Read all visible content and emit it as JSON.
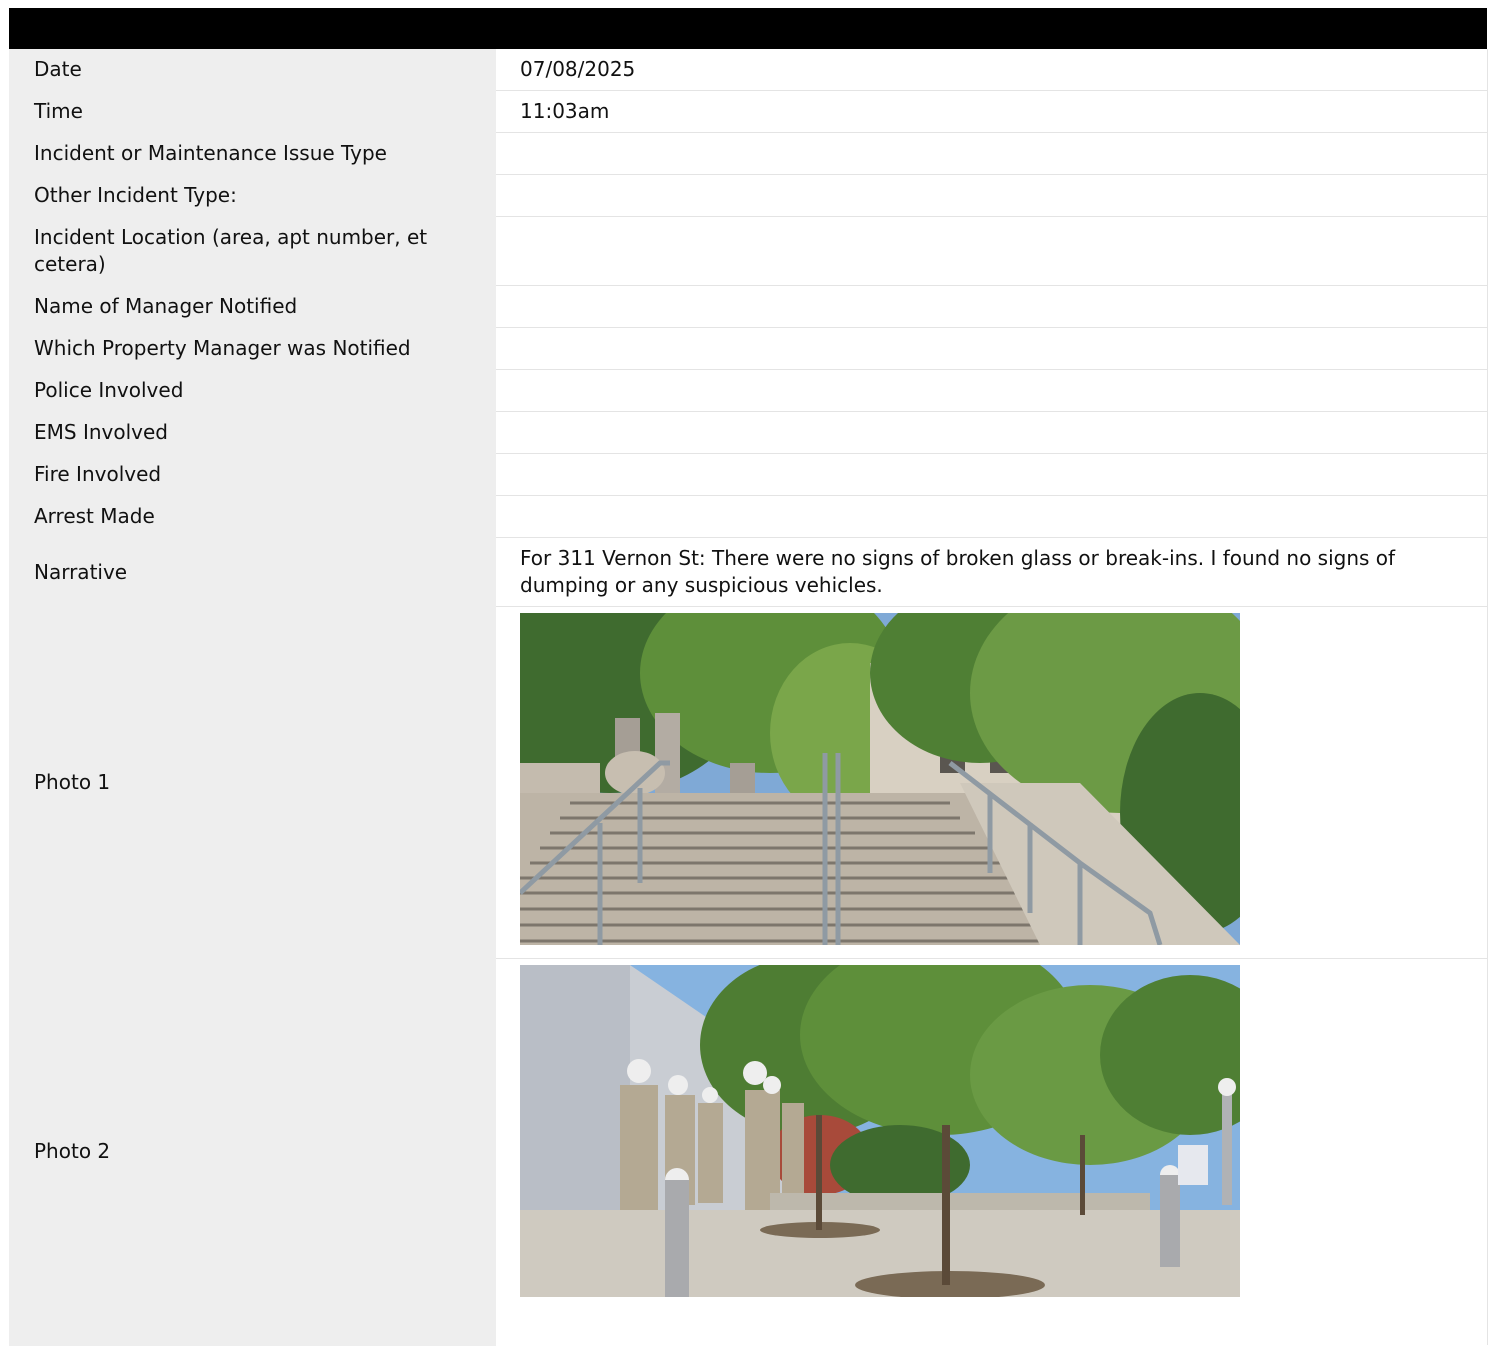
{
  "report": {
    "header_title": "",
    "rows": [
      {
        "label": "Date",
        "value": "07/08/2025"
      },
      {
        "label": "Time",
        "value": "11:03am"
      },
      {
        "label": "Incident or Maintenance Issue Type",
        "value": ""
      },
      {
        "label": "Other Incident Type:",
        "value": ""
      },
      {
        "label": "Incident Location (area, apt number, et cetera)",
        "value": ""
      },
      {
        "label": "Name of Manager Notified",
        "value": ""
      },
      {
        "label": "Which Property Manager was Notified",
        "value": ""
      },
      {
        "label": "Police Involved",
        "value": ""
      },
      {
        "label": "EMS Involved",
        "value": ""
      },
      {
        "label": "Fire Involved",
        "value": ""
      },
      {
        "label": "Arrest Made",
        "value": ""
      },
      {
        "label": "Narrative",
        "value": "For 311 Vernon St: There were no signs of broken glass or break-ins. I found no signs of dumping or any suspicious vehicles."
      }
    ],
    "photos": [
      {
        "label": "Photo 1"
      },
      {
        "label": "Photo 2"
      }
    ]
  },
  "colors": {
    "header_bar": "#000000",
    "label_column": "#eeeeee",
    "value_column": "#ffffff",
    "row_divider": "#e4e4e4"
  }
}
